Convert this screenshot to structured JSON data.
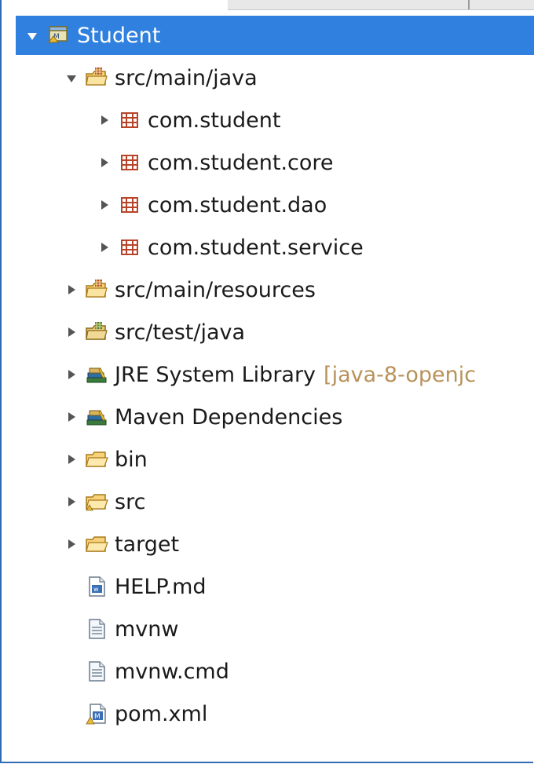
{
  "tree": {
    "items": [
      {
        "label": "Student",
        "icon": "project-icon",
        "state": "expanded",
        "selected": true
      },
      {
        "label": "src/main/java",
        "icon": "source-folder-icon",
        "state": "expanded"
      },
      {
        "label": "com.student",
        "icon": "package-icon",
        "state": "collapsed"
      },
      {
        "label": "com.student.core",
        "icon": "package-icon",
        "state": "collapsed"
      },
      {
        "label": "com.student.dao",
        "icon": "package-icon",
        "state": "collapsed"
      },
      {
        "label": "com.student.service",
        "icon": "package-icon",
        "state": "collapsed"
      },
      {
        "label": "src/main/resources",
        "icon": "source-folder-icon",
        "state": "collapsed"
      },
      {
        "label": "src/test/java",
        "icon": "test-source-folder-icon",
        "state": "collapsed"
      },
      {
        "label": "JRE System Library",
        "decoration": "[java-8-openjc",
        "icon": "library-icon",
        "state": "collapsed"
      },
      {
        "label": "Maven Dependencies",
        "icon": "library-icon",
        "state": "collapsed"
      },
      {
        "label": "bin",
        "icon": "folder-icon",
        "state": "collapsed"
      },
      {
        "label": "src",
        "icon": "folder-icon",
        "state": "collapsed"
      },
      {
        "label": "target",
        "icon": "folder-icon",
        "state": "collapsed"
      },
      {
        "label": "HELP.md",
        "icon": "markdown-file-icon",
        "state": "none"
      },
      {
        "label": "mvnw",
        "icon": "text-file-icon",
        "state": "none"
      },
      {
        "label": "mvnw.cmd",
        "icon": "text-file-icon",
        "state": "none"
      },
      {
        "label": "pom.xml",
        "icon": "maven-pom-icon",
        "state": "none"
      }
    ]
  },
  "colors": {
    "selection": "#2f80df",
    "decoration": "#b8925a",
    "border": "#2e6db4"
  }
}
